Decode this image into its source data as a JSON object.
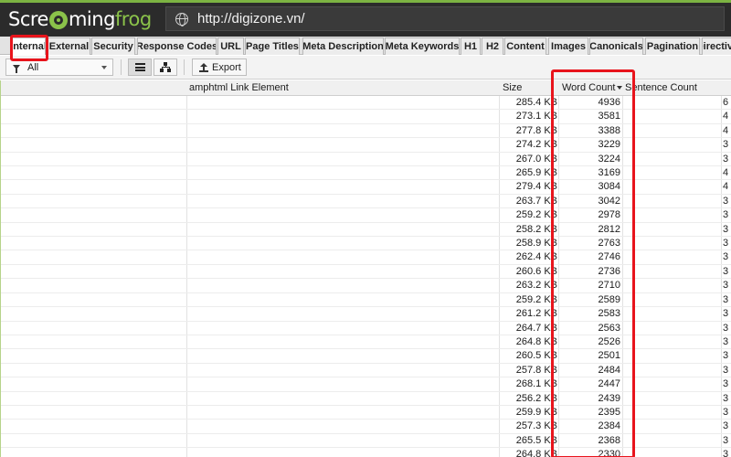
{
  "app": {
    "logo": {
      "part1": "Scre",
      "part2": "ming",
      "part3": "frog"
    },
    "url": "http://digizone.vn/"
  },
  "tabs": [
    {
      "label": "Internal",
      "active": true
    },
    {
      "label": "External"
    },
    {
      "label": "Security"
    },
    {
      "label": "Response Codes"
    },
    {
      "label": "URL"
    },
    {
      "label": "Page Titles"
    },
    {
      "label": "Meta Description"
    },
    {
      "label": "Meta Keywords"
    },
    {
      "label": "H1"
    },
    {
      "label": "H2"
    },
    {
      "label": "Content"
    },
    {
      "label": "Images"
    },
    {
      "label": "Canonicals"
    },
    {
      "label": "Pagination"
    },
    {
      "label": "Directives"
    }
  ],
  "toolbar": {
    "filter_value": "All",
    "export_label": "Export"
  },
  "table": {
    "columns": {
      "amphtml": "amphtml Link Element",
      "size": "Size",
      "word_count": "Word Count",
      "sentence_count": "Sentence Count"
    },
    "sort_column": "Word Count",
    "sort_direction": "descending",
    "rows": [
      {
        "size": "285.4 KB",
        "word_count": "4936",
        "sentence_count": "6"
      },
      {
        "size": "273.1 KB",
        "word_count": "3581",
        "sentence_count": "4"
      },
      {
        "size": "277.8 KB",
        "word_count": "3388",
        "sentence_count": "4"
      },
      {
        "size": "274.2 KB",
        "word_count": "3229",
        "sentence_count": "3"
      },
      {
        "size": "267.0 KB",
        "word_count": "3224",
        "sentence_count": "3"
      },
      {
        "size": "265.9 KB",
        "word_count": "3169",
        "sentence_count": "4"
      },
      {
        "size": "279.4 KB",
        "word_count": "3084",
        "sentence_count": "4"
      },
      {
        "size": "263.7 KB",
        "word_count": "3042",
        "sentence_count": "3"
      },
      {
        "size": "259.2 KB",
        "word_count": "2978",
        "sentence_count": "3"
      },
      {
        "size": "258.2 KB",
        "word_count": "2812",
        "sentence_count": "3"
      },
      {
        "size": "258.9 KB",
        "word_count": "2763",
        "sentence_count": "3"
      },
      {
        "size": "262.4 KB",
        "word_count": "2746",
        "sentence_count": "3"
      },
      {
        "size": "260.6 KB",
        "word_count": "2736",
        "sentence_count": "3"
      },
      {
        "size": "263.2 KB",
        "word_count": "2710",
        "sentence_count": "3"
      },
      {
        "size": "259.2 KB",
        "word_count": "2589",
        "sentence_count": "3"
      },
      {
        "size": "261.2 KB",
        "word_count": "2583",
        "sentence_count": "3"
      },
      {
        "size": "264.7 KB",
        "word_count": "2563",
        "sentence_count": "3"
      },
      {
        "size": "264.8 KB",
        "word_count": "2526",
        "sentence_count": "3"
      },
      {
        "size": "260.5 KB",
        "word_count": "2501",
        "sentence_count": "3"
      },
      {
        "size": "257.8 KB",
        "word_count": "2484",
        "sentence_count": "3"
      },
      {
        "size": "268.1 KB",
        "word_count": "2447",
        "sentence_count": "3"
      },
      {
        "size": "256.2 KB",
        "word_count": "2439",
        "sentence_count": "3"
      },
      {
        "size": "259.9 KB",
        "word_count": "2395",
        "sentence_count": "3"
      },
      {
        "size": "257.3 KB",
        "word_count": "2384",
        "sentence_count": "3"
      },
      {
        "size": "265.5 KB",
        "word_count": "2368",
        "sentence_count": "3"
      },
      {
        "size": "264.8 KB",
        "word_count": "2330",
        "sentence_count": "3"
      }
    ]
  },
  "colors": {
    "header_bg": "#2b2b2b",
    "brand_green": "#8bc34a",
    "annotation_red": "#e8141c"
  }
}
